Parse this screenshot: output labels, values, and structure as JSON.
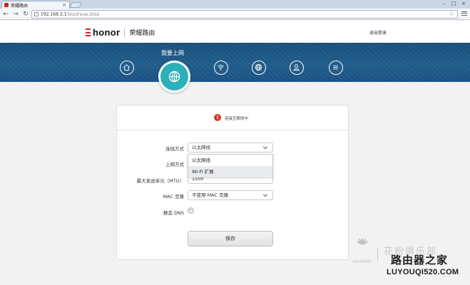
{
  "browser": {
    "tab_title": "荣耀路由",
    "tab_close": "×",
    "url_host": "192.168.3.1",
    "url_path": "/html/wan.html",
    "window_controls": [
      "–",
      "□",
      "×"
    ]
  },
  "header": {
    "brand_logo": "honor",
    "brand_name": "荣耀路由",
    "logout_label": "退出登录"
  },
  "nav": {
    "title": "我要上网",
    "items": [
      {
        "name": "home-icon",
        "active": false
      },
      {
        "name": "globe-icon",
        "active": true
      },
      {
        "name": "wifi-icon",
        "active": false
      },
      {
        "name": "network-globe-icon",
        "active": false
      },
      {
        "name": "user-icon",
        "active": false
      },
      {
        "name": "menu-icon",
        "active": false
      }
    ],
    "active_color": "#2ab0b9"
  },
  "status": {
    "icon_glyph": "!",
    "text": "连接互联网中"
  },
  "form": {
    "connection_mode_label": "连线方式",
    "connection_mode_value": "以太网线",
    "connection_mode_options": [
      "以太网线",
      "Wi-Fi 扩展"
    ],
    "internet_mode_label": "上网方式",
    "mtu_label": "最大发送单元（MTU）",
    "mtu_value": "1500",
    "mac_clone_label": "MAC 克隆",
    "mac_clone_value": "不使用 MAC 克隆",
    "static_dns_label": "静态 DNS",
    "save_label": "保存"
  },
  "watermark": {
    "huawei": "HUAWEI",
    "flower": "花粉俱乐部",
    "site_cn": "路由器之家",
    "site_url": "LUYOUQI520.COM"
  },
  "colors": {
    "nav_band": "#1f5c8a",
    "status_icon": "#d9392a",
    "brand_red": "#c8262d"
  }
}
